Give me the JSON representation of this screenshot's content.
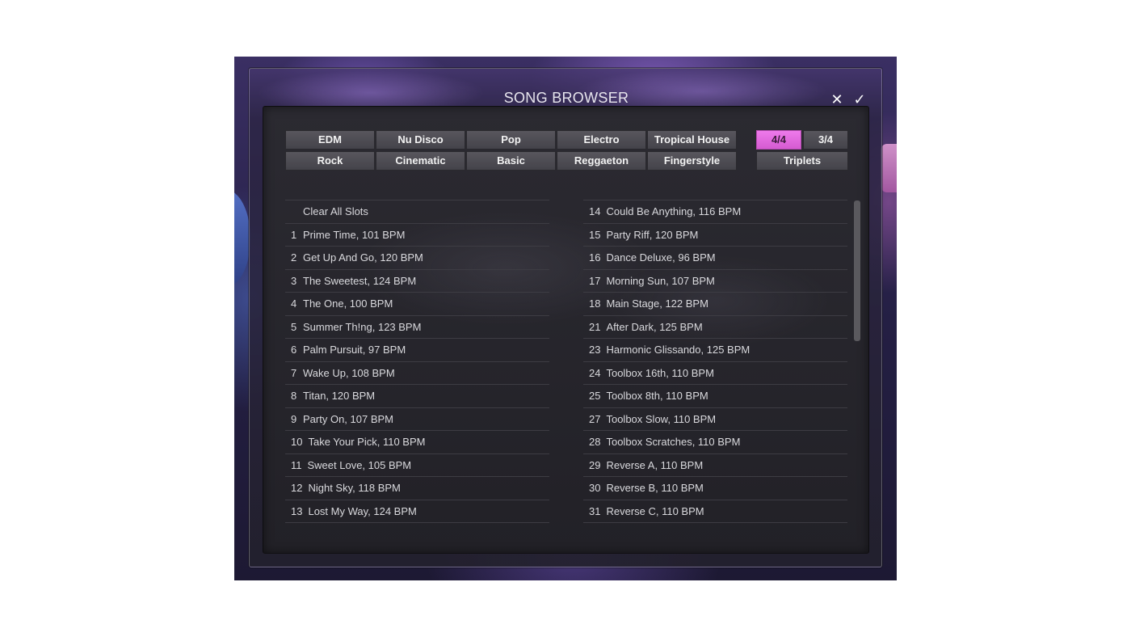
{
  "dialog": {
    "title": "SONG BROWSER",
    "close_icon": "✕",
    "confirm_icon": "✓"
  },
  "genres": [
    [
      "EDM",
      "Nu Disco",
      "Pop",
      "Electro",
      "Tropical House"
    ],
    [
      "Rock",
      "Cinematic",
      "Basic",
      "Reggaeton",
      "Fingerstyle"
    ]
  ],
  "meters": {
    "four_four": "4/4",
    "three_four": "3/4",
    "triplets": "Triplets",
    "selected": "4/4"
  },
  "colors": {
    "accent": "#e46be0"
  },
  "left_list": {
    "clear_label": "Clear All Slots",
    "songs": [
      {
        "num": "1",
        "title": "Prime Time, 101 BPM"
      },
      {
        "num": "2",
        "title": "Get Up And Go, 120 BPM"
      },
      {
        "num": "3",
        "title": "The Sweetest, 124 BPM"
      },
      {
        "num": "4",
        "title": "The One, 100 BPM"
      },
      {
        "num": "5",
        "title": "Summer Th!ng, 123 BPM"
      },
      {
        "num": "6",
        "title": "Palm Pursuit, 97 BPM"
      },
      {
        "num": "7",
        "title": "Wake Up, 108 BPM"
      },
      {
        "num": "8",
        "title": "Titan, 120 BPM"
      },
      {
        "num": "9",
        "title": "Party On, 107 BPM"
      },
      {
        "num": "10",
        "title": "Take Your Pick, 110 BPM"
      },
      {
        "num": "11",
        "title": "Sweet Love, 105 BPM"
      },
      {
        "num": "12",
        "title": "Night Sky, 118 BPM"
      },
      {
        "num": "13",
        "title": "Lost My Way, 124 BPM"
      }
    ]
  },
  "right_list": {
    "songs": [
      {
        "num": "14",
        "title": "Could Be Anything, 116 BPM"
      },
      {
        "num": "15",
        "title": "Party Riff, 120 BPM"
      },
      {
        "num": "16",
        "title": "Dance Deluxe, 96 BPM"
      },
      {
        "num": "17",
        "title": "Morning Sun, 107 BPM"
      },
      {
        "num": "18",
        "title": "Main Stage, 122 BPM"
      },
      {
        "num": "21",
        "title": "After Dark, 125 BPM"
      },
      {
        "num": "23",
        "title": "Harmonic Glissando, 125 BPM"
      },
      {
        "num": "24",
        "title": "Toolbox 16th, 110 BPM"
      },
      {
        "num": "25",
        "title": "Toolbox 8th, 110 BPM"
      },
      {
        "num": "27",
        "title": "Toolbox Slow, 110 BPM"
      },
      {
        "num": "28",
        "title": "Toolbox Scratches, 110 BPM"
      },
      {
        "num": "29",
        "title": "Reverse A, 110 BPM"
      },
      {
        "num": "30",
        "title": "Reverse B, 110 BPM"
      },
      {
        "num": "31",
        "title": "Reverse C, 110 BPM"
      }
    ]
  }
}
